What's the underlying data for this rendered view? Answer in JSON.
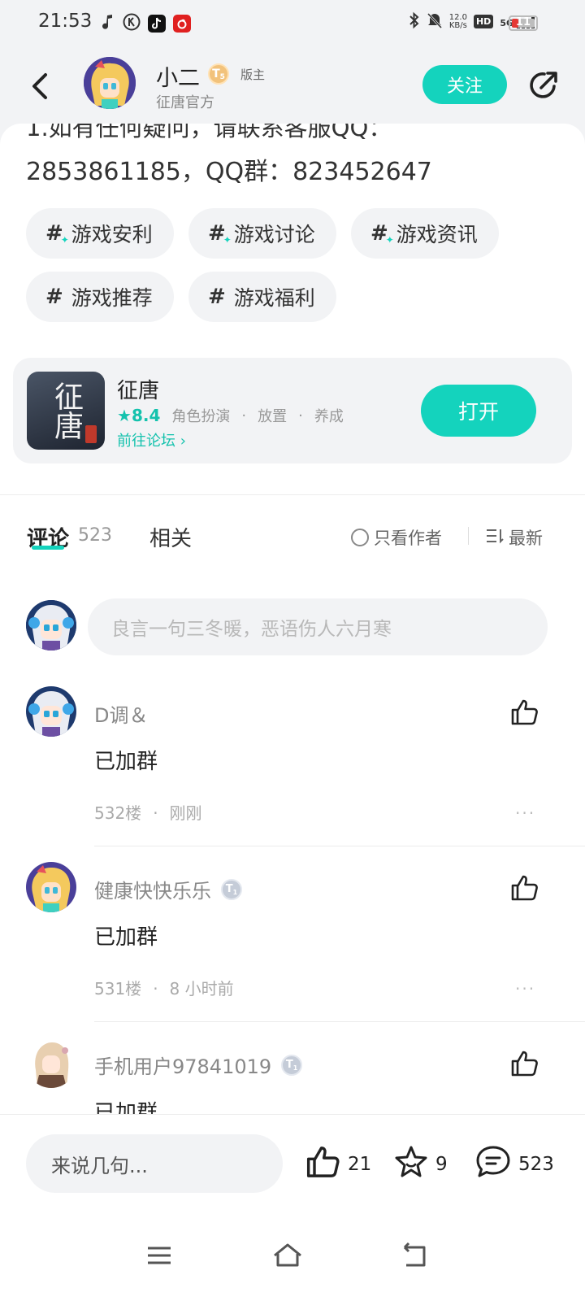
{
  "status_bar": {
    "time": "21:53",
    "net_speed_value": "12.0",
    "net_speed_unit": "KB/s",
    "hd": "HD",
    "signal": "5G",
    "battery": "11",
    "icons": [
      "music-note-icon",
      "k-app-icon",
      "tiktok-icon",
      "netease-music-icon",
      "bluetooth-icon",
      "mute-icon"
    ]
  },
  "header": {
    "author_name": "小二",
    "level_badge": "5",
    "role": "版主",
    "subtitle": "征唐官方",
    "follow_label": "关注"
  },
  "post": {
    "text_cut": "1.如有任何疑问，请联系客服QQ：",
    "text_line": "2853861185，QQ群：823452647",
    "tags": [
      "游戏安利",
      "游戏讨论",
      "游戏资讯",
      "游戏推荐",
      "游戏福利"
    ]
  },
  "game": {
    "name": "征唐",
    "icon_text": "征唐",
    "score": "8.4",
    "genres": [
      "角色扮演",
      "放置",
      "养成"
    ],
    "forum_link": "前往论坛",
    "open_label": "打开"
  },
  "tabs": {
    "comments_label": "评论",
    "comments_count": "523",
    "related_label": "相关",
    "only_author": "只看作者",
    "sort": "最新"
  },
  "comment_input": {
    "placeholder": "良言一句三冬暖，恶语伤人六月寒"
  },
  "comments": [
    {
      "name": "D调＆",
      "level": "",
      "text": "已加群",
      "floor": "532楼",
      "time": "刚刚"
    },
    {
      "name": "健康快快乐乐",
      "level": "1",
      "text": "已加群",
      "floor": "531楼",
      "time": "8 小时前"
    },
    {
      "name": "手机用户97841019",
      "level": "1",
      "text": "已加群",
      "floor": "",
      "time": ""
    }
  ],
  "bottom_bar": {
    "input_placeholder": "来说几句...",
    "likes": "21",
    "favorites": "9",
    "comments": "523"
  },
  "colors": {
    "accent": "#14d3bd",
    "background": "#f2f3f5"
  }
}
